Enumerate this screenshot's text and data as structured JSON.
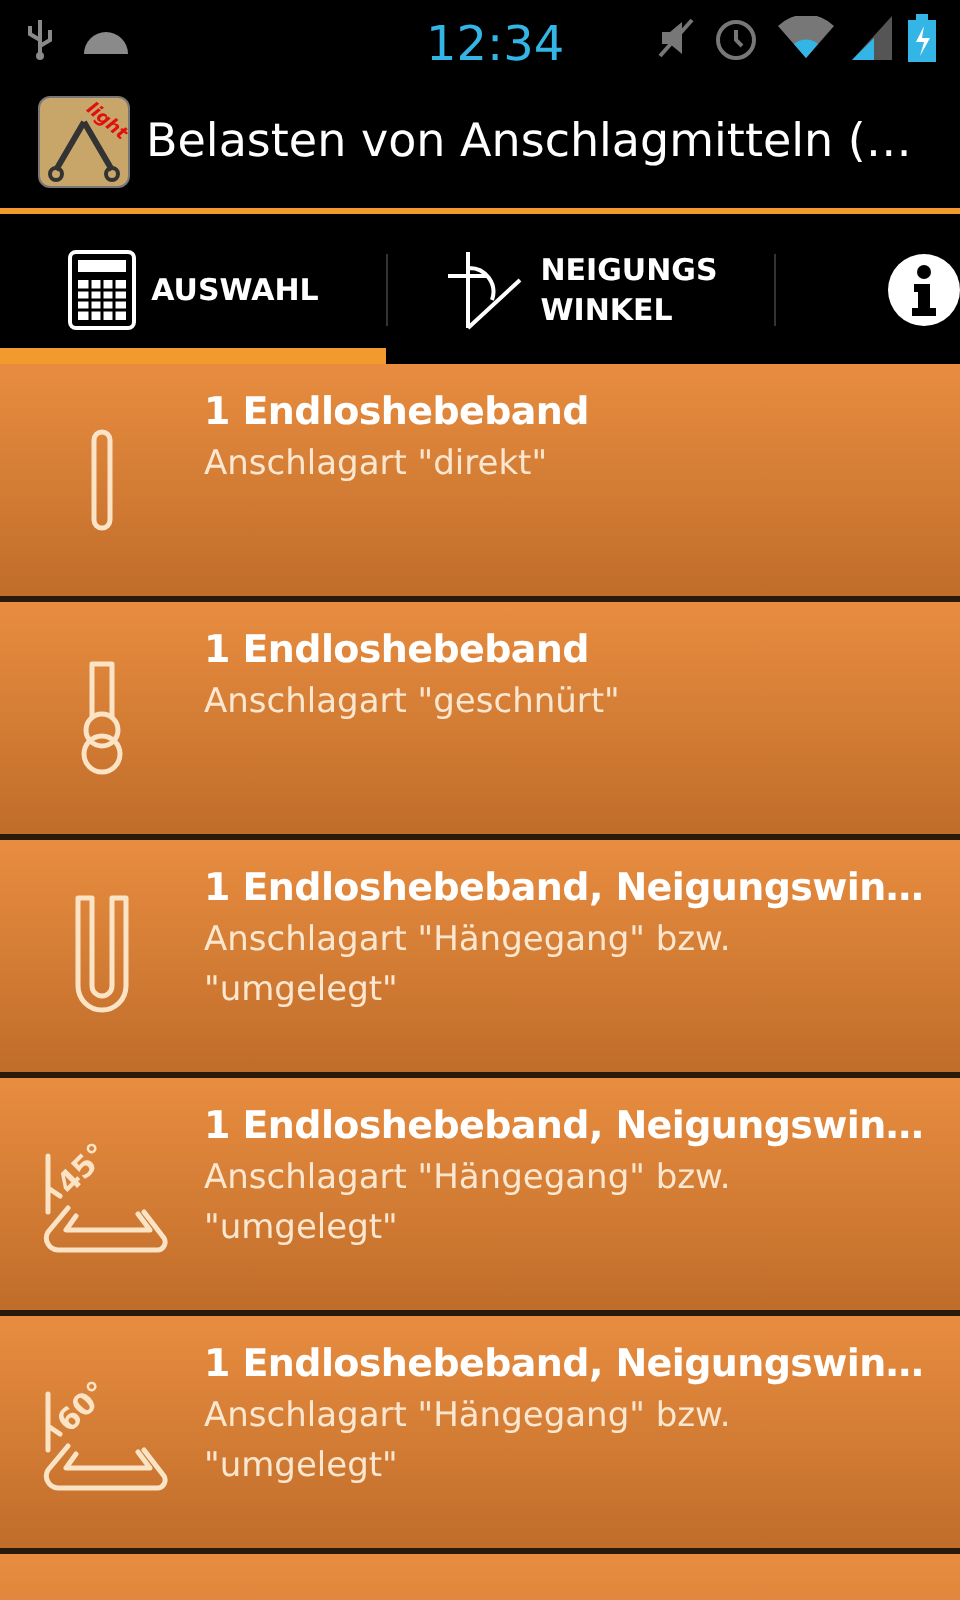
{
  "status_bar": {
    "time": "12:34"
  },
  "action_bar": {
    "title": "Belasten von Anschlagmitteln (…",
    "app_icon_badge": "light"
  },
  "tabs": [
    {
      "kind": "calculator",
      "label": "AUSWAHL",
      "selected": true
    },
    {
      "kind": "angle",
      "label": "NEIGUNGS\nWINKEL",
      "selected": false
    },
    {
      "kind": "info",
      "selected": false
    }
  ],
  "items": [
    {
      "kind": "straight",
      "title": "1 Endloshebeband",
      "subtitle": "Anschlagart \"direkt\""
    },
    {
      "kind": "choked",
      "title": "1 Endloshebeband",
      "subtitle": "Anschlagart \"geschnürt\""
    },
    {
      "kind": "basket",
      "title": "1 Endloshebeband, Neigungswin…",
      "subtitle": "Anschlagart \"Hängegang\" bzw. \"umgelegt\""
    },
    {
      "kind": "angled",
      "angle_label": "45°",
      "title": "1 Endloshebeband, Neigungswin…",
      "subtitle": "Anschlagart \"Hängegang\" bzw. \"umgelegt\""
    },
    {
      "kind": "angled",
      "angle_label": "60°",
      "title": "1 Endloshebeband, Neigungswin…",
      "subtitle": "Anschlagart \"Hängegang\" bzw. \"umgelegt\""
    },
    {
      "kind": "partial"
    }
  ]
}
